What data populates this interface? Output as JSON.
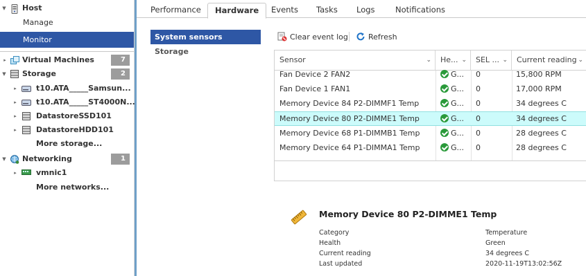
{
  "navigator": {
    "host": {
      "label": "Host",
      "icon": "host-icon"
    },
    "manage": {
      "label": "Manage"
    },
    "monitor": {
      "label": "Monitor"
    },
    "virtual_machines": {
      "label": "Virtual Machines",
      "count": "7",
      "icon": "vm-icon"
    },
    "storage": {
      "label": "Storage",
      "count": "2",
      "icon": "storage-icon"
    },
    "storage_items": [
      {
        "label": "t10.ATA_____Samsun...",
        "icon": "disk-icon"
      },
      {
        "label": "t10.ATA_____ST4000N...",
        "icon": "disk-icon"
      },
      {
        "label": "DatastoreSSD101",
        "icon": "datastore-icon"
      },
      {
        "label": "DatastoreHDD101",
        "icon": "datastore-icon"
      }
    ],
    "more_storage": "More storage...",
    "networking": {
      "label": "Networking",
      "count": "1",
      "icon": "network-icon"
    },
    "network_items": [
      {
        "label": "vmnic1",
        "icon": "nic-icon"
      }
    ],
    "more_networks": "More networks..."
  },
  "tabs": [
    {
      "label": "Performance"
    },
    {
      "label": "Hardware",
      "active": true
    },
    {
      "label": "Events"
    },
    {
      "label": "Tasks"
    },
    {
      "label": "Logs"
    },
    {
      "label": "Notifications"
    }
  ],
  "subnav": [
    {
      "label": "System sensors",
      "active": true
    },
    {
      "label": "Storage"
    }
  ],
  "toolbar": {
    "clear_event_log": "Clear event log",
    "refresh": "Refresh"
  },
  "grid": {
    "columns": [
      "Sensor",
      "He...",
      "SEL ...",
      "Current reading"
    ],
    "rows": [
      {
        "sensor": "Fan Device 2 FAN2",
        "health": "G...",
        "sel": "0",
        "reading": "15,800 RPM"
      },
      {
        "sensor": "Fan Device 1 FAN1",
        "health": "G...",
        "sel": "0",
        "reading": "17,000 RPM"
      },
      {
        "sensor": "Memory Device 84 P2-DIMMF1 Temp",
        "health": "G...",
        "sel": "0",
        "reading": "34 degrees C"
      },
      {
        "sensor": "Memory Device 80 P2-DIMME1 Temp",
        "health": "G...",
        "sel": "0",
        "reading": "34 degrees C",
        "selected": true
      },
      {
        "sensor": "Memory Device 68 P1-DIMMB1 Temp",
        "health": "G...",
        "sel": "0",
        "reading": "28 degrees C"
      },
      {
        "sensor": "Memory Device 64 P1-DIMMA1 Temp",
        "health": "G...",
        "sel": "0",
        "reading": "28 degrees C"
      }
    ]
  },
  "detail": {
    "title": "Memory Device 80 P2-DIMME1 Temp",
    "icon": "thermometer-icon",
    "fields": [
      {
        "label": "Category",
        "value": "Temperature"
      },
      {
        "label": "Health",
        "value": "Green"
      },
      {
        "label": "Current reading",
        "value": "34 degrees C"
      },
      {
        "label": "Last updated",
        "value": "2020-11-19T13:02:56Z"
      }
    ]
  }
}
